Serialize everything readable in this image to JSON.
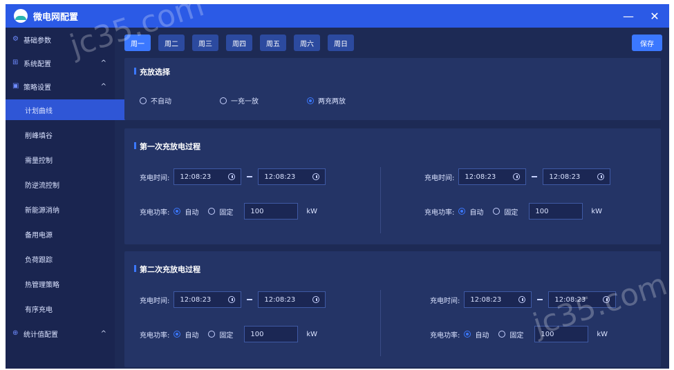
{
  "window": {
    "title": "微电网配置",
    "minimize": "—",
    "close": "✕"
  },
  "sidebar": {
    "items": [
      {
        "label": "基础参数",
        "icon": "settings-icon"
      },
      {
        "label": "系统配置",
        "icon": "network-icon",
        "chevron": "^"
      },
      {
        "label": "策略设置",
        "icon": "strategy-icon",
        "chevron": "^"
      },
      {
        "label": "计划曲线",
        "active": true
      },
      {
        "label": "削峰填谷"
      },
      {
        "label": "需量控制"
      },
      {
        "label": "防逆流控制"
      },
      {
        "label": "新能源消纳"
      },
      {
        "label": "备用电源"
      },
      {
        "label": "负荷跟踪"
      },
      {
        "label": "热管理策略"
      },
      {
        "label": "有序充电"
      },
      {
        "label": "统计值配置",
        "icon": "stats-icon",
        "chevron": "^"
      }
    ]
  },
  "days": [
    "周一",
    "周二",
    "周三",
    "周四",
    "周五",
    "周六",
    "周日"
  ],
  "active_day": 0,
  "save_label": "保存",
  "charge_select": {
    "title": "充放选择",
    "options": [
      "不自动",
      "一充一放",
      "两充两放"
    ],
    "selected": 2
  },
  "process1": {
    "title": "第一次充放电过程",
    "left": {
      "time_label": "充电时间:",
      "start": "12:08:23",
      "end": "12:08:23",
      "power_label": "充电功率:",
      "mode_auto": "自动",
      "mode_fixed": "固定",
      "selected_mode": "auto",
      "power_value": "100",
      "unit": "kW"
    },
    "right": {
      "time_label": "充电时间:",
      "start": "12:08:23",
      "end": "12:08:23",
      "power_label": "充电功率:",
      "mode_auto": "自动",
      "mode_fixed": "固定",
      "selected_mode": "auto",
      "power_value": "100",
      "unit": "kW"
    }
  },
  "process2": {
    "title": "第二次充放电过程",
    "left": {
      "time_label": "充电时间:",
      "start": "12:08:23",
      "end": "12:08:23",
      "power_label": "充电功率:",
      "mode_auto": "自动",
      "mode_fixed": "固定",
      "selected_mode": "auto",
      "power_value": "100",
      "unit": "kW"
    },
    "right": {
      "time_label": "充电时间:",
      "start": "12:08:23",
      "end": "12:08:23",
      "power_label": "充电功率:",
      "mode_auto": "自动",
      "mode_fixed": "固定",
      "selected_mode": "auto",
      "power_value": "100",
      "unit": "kW"
    }
  },
  "watermark": "jc35.com",
  "colors": {
    "accent": "#3b78ff",
    "titlebar": "#2b5ae6",
    "bg": "#1d2a55",
    "panel": "#243466"
  }
}
